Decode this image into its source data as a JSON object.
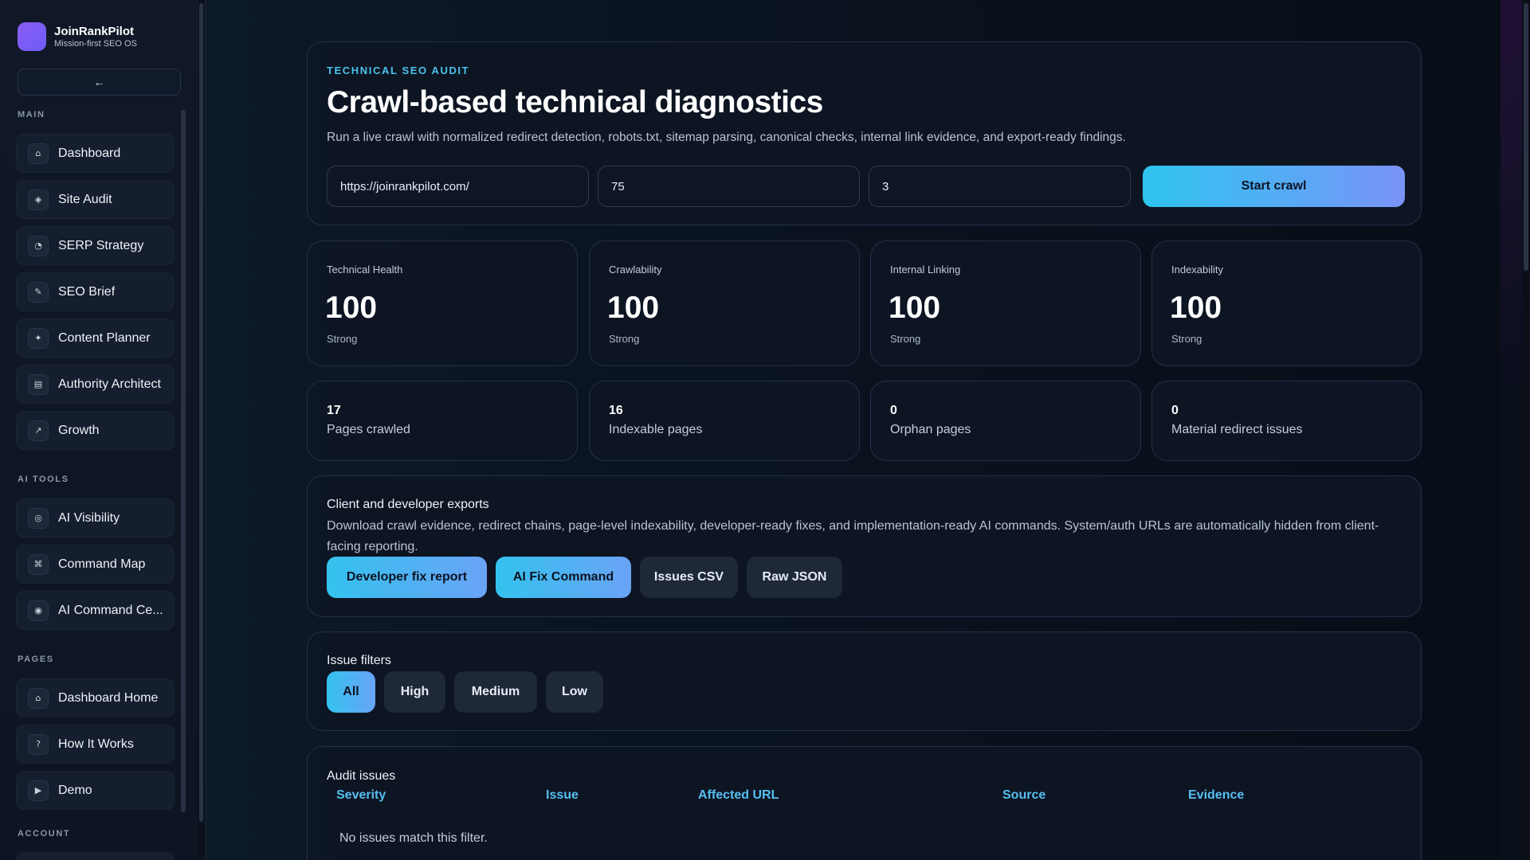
{
  "brand": {
    "name": "JoinRankPilot",
    "tagline": "Mission-first SEO OS"
  },
  "sidebar": {
    "collapse_label": "←",
    "sections": {
      "main": "MAIN",
      "ai_tools": "AI TOOLS",
      "pages": "PAGES",
      "account": "ACCOUNT"
    },
    "main_items": [
      {
        "label": "Dashboard",
        "icon": "⌂",
        "icon_name": "home-icon"
      },
      {
        "label": "Site Audit",
        "icon": "◈",
        "icon_name": "diamond-icon"
      },
      {
        "label": "SERP Strategy",
        "icon": "◔",
        "icon_name": "chart-icon"
      },
      {
        "label": "SEO Brief",
        "icon": "✎",
        "icon_name": "pen-icon"
      },
      {
        "label": "Content Planner",
        "icon": "✦",
        "icon_name": "sparkle-icon"
      },
      {
        "label": "Authority Architect",
        "icon": "▤",
        "icon_name": "grid-icon"
      },
      {
        "label": "Growth",
        "icon": "↗",
        "icon_name": "trend-up-icon"
      }
    ],
    "ai_items": [
      {
        "label": "AI Visibility",
        "icon": "◎",
        "icon_name": "eye-icon"
      },
      {
        "label": "Command Map",
        "icon": "⌘",
        "icon_name": "command-icon"
      },
      {
        "label": "AI Command Ce...",
        "icon": "◉",
        "icon_name": "target-icon"
      }
    ],
    "page_items": [
      {
        "label": "Dashboard Home",
        "icon": "⌂",
        "icon_name": "home-icon"
      },
      {
        "label": "How It Works",
        "icon": "?",
        "icon_name": "question-icon"
      },
      {
        "label": "Demo",
        "icon": "▶",
        "icon_name": "play-icon"
      }
    ]
  },
  "hero": {
    "eyebrow": "TECHNICAL SEO AUDIT",
    "title": "Crawl-based technical diagnostics",
    "description": "Run a live crawl with normalized redirect detection, robots.txt, sitemap parsing, canonical checks, internal link evidence, and export-ready findings.",
    "url_value": "https://joinrankpilot.com/",
    "max_pages_value": "75",
    "depth_value": "3",
    "start_label": "Start crawl"
  },
  "metrics": [
    {
      "label": "Technical Health",
      "value": "100",
      "status": "Strong"
    },
    {
      "label": "Crawlability",
      "value": "100",
      "status": "Strong"
    },
    {
      "label": "Internal Linking",
      "value": "100",
      "status": "Strong"
    },
    {
      "label": "Indexability",
      "value": "100",
      "status": "Strong"
    }
  ],
  "stats": [
    {
      "value": "17",
      "label": "Pages crawled"
    },
    {
      "value": "16",
      "label": "Indexable pages"
    },
    {
      "value": "0",
      "label": "Orphan pages"
    },
    {
      "value": "0",
      "label": "Material redirect issues"
    }
  ],
  "exports": {
    "title": "Client and developer exports",
    "description": "Download crawl evidence, redirect chains, page-level indexability, developer-ready fixes, and implementation-ready AI commands. System/auth URLs are automatically hidden from client-facing reporting.",
    "buttons": [
      "Developer fix report",
      "AI Fix Command",
      "Issues CSV",
      "Raw JSON"
    ]
  },
  "filters": {
    "title": "Issue filters",
    "options": [
      "All",
      "High",
      "Medium",
      "Low"
    ]
  },
  "issues": {
    "title": "Audit issues",
    "columns": [
      "Severity",
      "Issue",
      "Affected URL",
      "Source",
      "Evidence"
    ],
    "empty_text": "No issues match this filter."
  }
}
